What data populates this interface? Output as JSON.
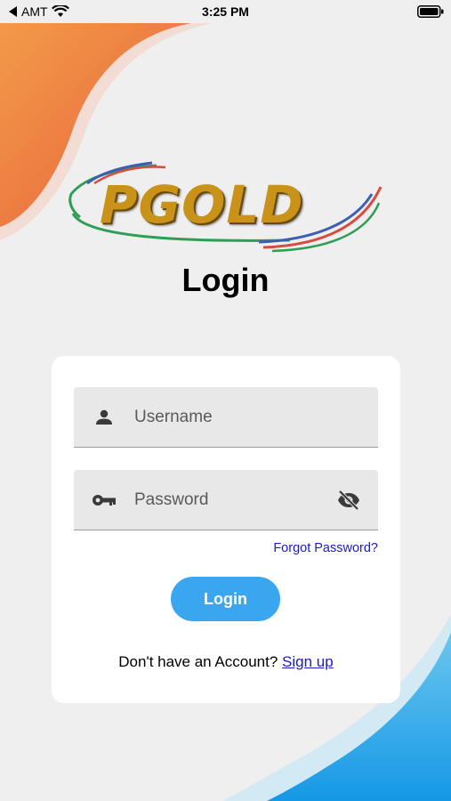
{
  "status_bar": {
    "carrier": "AMT",
    "time": "3:25 PM",
    "icons": [
      "back-arrow-icon",
      "wifi-icon",
      "battery-icon"
    ]
  },
  "logo": {
    "text": "PGOLD"
  },
  "title": "Login",
  "form": {
    "username": {
      "value": "",
      "placeholder": "Username",
      "icon": "person-icon"
    },
    "password": {
      "value": "",
      "placeholder": "Password",
      "icon": "key-icon",
      "toggle_icon": "eye-off-icon"
    },
    "forgot_label": "Forgot Password?",
    "login_label": "Login",
    "signup_prompt": "Don't have an Account?",
    "signup_label": "Sign up"
  },
  "colors": {
    "background": "#efefef",
    "accent_blue": "#3aa6ef",
    "link_blue": "#1a1acc",
    "orange_corner": "#ec7640",
    "card": "#ffffff"
  }
}
